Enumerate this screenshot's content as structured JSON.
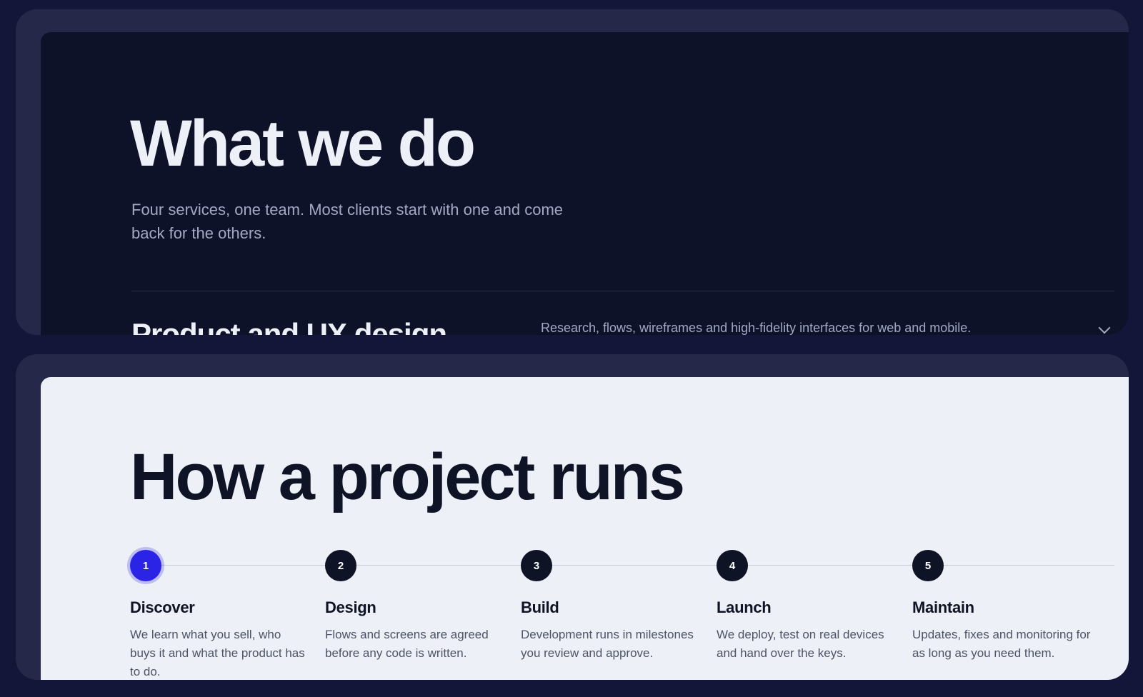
{
  "services": {
    "title": "What we do",
    "subtitle": "Four services, one team. Most clients start with one and come back for the others.",
    "items": [
      {
        "name": "Product and UX design",
        "description": "Research, flows, wireframes and high-fidelity interfaces for web and mobile.",
        "icon": "chevron-down-icon"
      }
    ]
  },
  "process": {
    "title": "How a project runs",
    "active_step": 1,
    "steps": [
      {
        "number": "1",
        "title": "Discover",
        "description": "We learn what you sell, who buys it and what the product has to do."
      },
      {
        "number": "2",
        "title": "Design",
        "description": "Flows and screens are agreed before any code is written."
      },
      {
        "number": "3",
        "title": "Build",
        "description": "Development runs in milestones you review and approve."
      },
      {
        "number": "4",
        "title": "Launch",
        "description": "We deploy, test on real devices and hand over the keys."
      },
      {
        "number": "5",
        "title": "Maintain",
        "description": "Updates, fixes and monitoring for as long as you need them."
      }
    ]
  },
  "colors": {
    "page_background": "#131638",
    "frame": "#262849",
    "dark_panel": "#0d1229",
    "light_panel": "#edf0f6",
    "accent": "#2b24e6"
  }
}
